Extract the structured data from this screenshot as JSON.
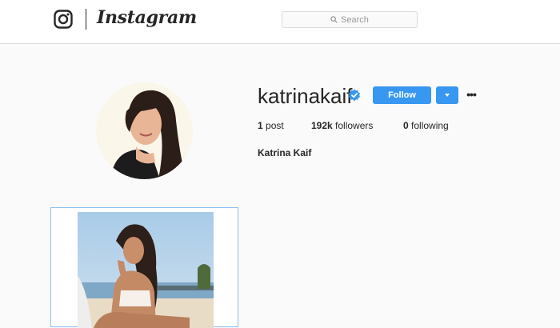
{
  "header": {
    "logo_icon": "instagram-camera-icon",
    "wordmark": "Instagram",
    "search": {
      "icon": "search-icon",
      "placeholder": "Search"
    }
  },
  "profile": {
    "username": "katrinakaif",
    "verified_icon": "verified-badge-icon",
    "follow_label": "Follow",
    "more_icon": "chevron-down-icon",
    "options_icon": "ellipsis-icon",
    "stats": {
      "posts_count": "1",
      "posts_label": "post",
      "followers_count": "192k",
      "followers_label": "followers",
      "following_count": "0",
      "following_label": "following"
    },
    "full_name": "Katrina Kaif"
  },
  "colors": {
    "accent": "#3897f0",
    "background": "#fafafa",
    "text": "#262626"
  }
}
